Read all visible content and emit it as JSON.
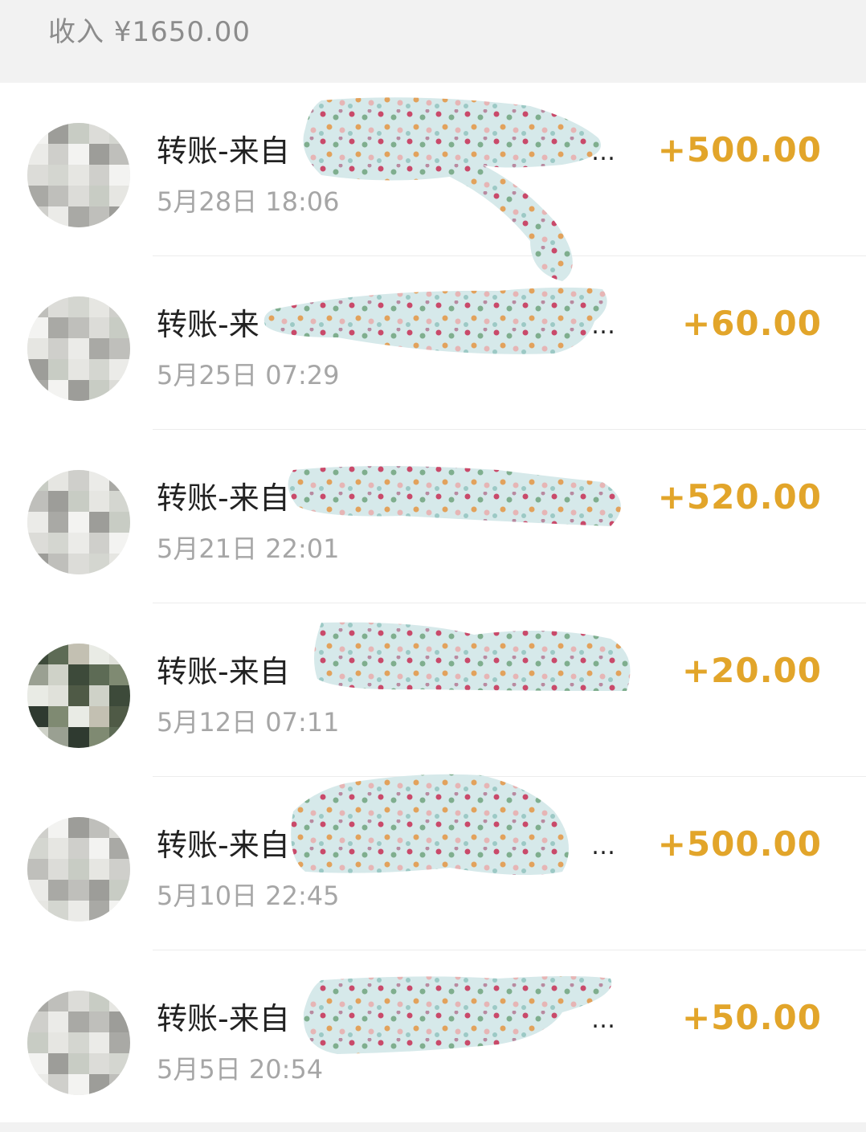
{
  "summary": {
    "income_label": "收入 ¥1650.00"
  },
  "colors": {
    "amount": "#e2a52a",
    "title": "#222222",
    "time": "#a6a6a6",
    "background_band": "#f2f2f2"
  },
  "transactions": [
    {
      "title": "转账-来自",
      "time": "5月28日 18:06",
      "amount": "+500.00",
      "avatar": "pixelated-avatar"
    },
    {
      "title": "转账-来",
      "time": "5月25日 07:29",
      "amount": "+60.00",
      "avatar": "pixelated-avatar"
    },
    {
      "title": "转账-来自",
      "time": "5月21日 22:01",
      "amount": "+520.00",
      "avatar": "pixelated-avatar"
    },
    {
      "title": "转账-来自",
      "time": "5月12日 07:11",
      "amount": "+20.00",
      "avatar": "pixelated-photo-avatar"
    },
    {
      "title": "转账-来自",
      "time": "5月10日 22:45",
      "amount": "+500.00",
      "avatar": "pixelated-avatar"
    },
    {
      "title": "转账-来自",
      "time": "5月5日 20:54",
      "amount": "+50.00",
      "avatar": "pixelated-avatar"
    }
  ],
  "ellipsis": "…"
}
